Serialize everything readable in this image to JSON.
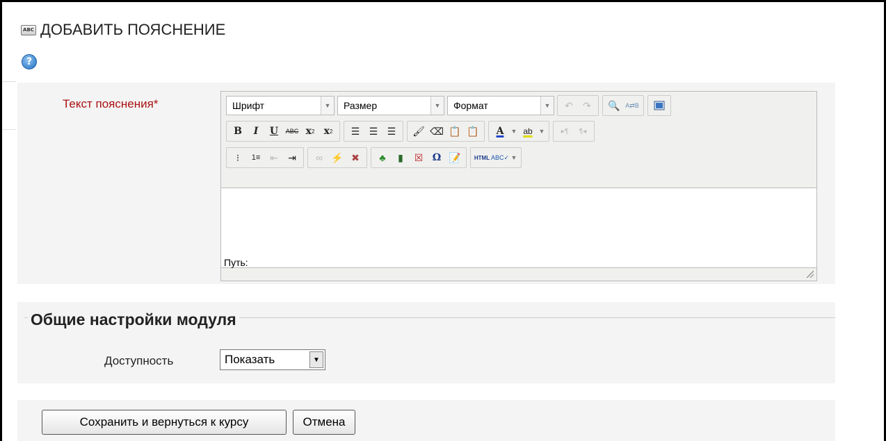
{
  "page_title": "ДОБАВИТЬ ПОЯСНЕНИЕ",
  "title_icon": "abc-icon",
  "help_icon": "help-icon",
  "field_label": "Текст пояснения",
  "required_mark": "*",
  "editor": {
    "font_select": "Шрифт",
    "size_select": "Размер",
    "format_select": "Формат",
    "path_label": "Путь:",
    "toolbar_row1_icons": [
      "undo-icon",
      "redo-icon",
      "find-icon",
      "replace-icon",
      "fullscreen-icon"
    ],
    "toolbar_row2_icons": [
      "bold-icon",
      "italic-icon",
      "underline-icon",
      "strikethrough-icon",
      "subscript-icon",
      "superscript-icon",
      "align-left-icon",
      "align-center-icon",
      "align-right-icon",
      "cleanup-icon",
      "eraser-icon",
      "paste-text-icon",
      "paste-word-icon",
      "text-color-icon",
      "highlight-color-icon",
      "ltr-icon",
      "rtl-icon"
    ],
    "toolbar_row3_icons": [
      "bullet-list-icon",
      "numbered-list-icon",
      "outdent-icon",
      "indent-icon",
      "link-icon",
      "unlink-icon",
      "anchor-icon",
      "image-icon",
      "media-icon",
      "nolink-icon",
      "special-char-icon",
      "edit-icon",
      "html-icon",
      "spellcheck-icon"
    ]
  },
  "general_settings": {
    "legend": "Общие настройки модуля",
    "availability_label": "Доступность",
    "availability_value": "Показать"
  },
  "buttons": {
    "save": "Сохранить и вернуться к курсу",
    "cancel": "Отмена"
  }
}
